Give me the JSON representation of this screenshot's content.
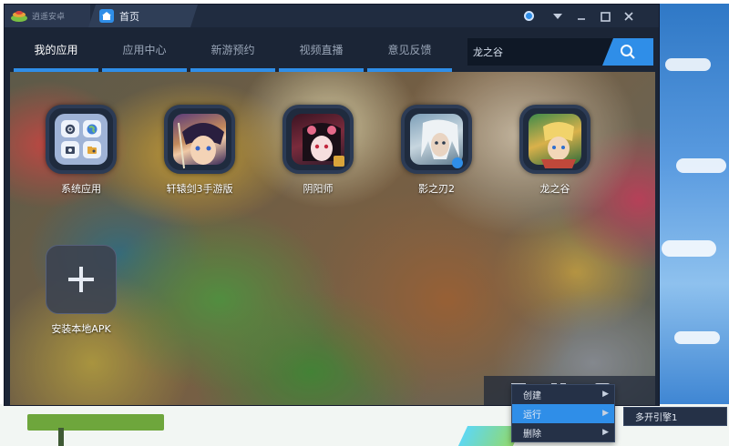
{
  "titlebar": {
    "brand_name": "逍遥安卓",
    "home_tab_label": "首页"
  },
  "nav": {
    "tabs": [
      {
        "label": "我的应用",
        "active": true
      },
      {
        "label": "应用中心",
        "active": false
      },
      {
        "label": "新游预约",
        "active": false
      },
      {
        "label": "视频直播",
        "active": false
      },
      {
        "label": "意见反馈",
        "active": false
      }
    ],
    "search_value": "龙之谷"
  },
  "apps": [
    {
      "label": "系统应用",
      "icon": "system-apps-icon"
    },
    {
      "label": "轩辕剑3手游版",
      "icon": "xuanyuan-game-icon"
    },
    {
      "label": "阴阳师",
      "icon": "onmyoji-game-icon"
    },
    {
      "label": "影之刃2",
      "icon": "blade-shadow-game-icon"
    },
    {
      "label": "龙之谷",
      "icon": "dragon-nest-game-icon"
    }
  ],
  "install_apk_label": "安装本地APK",
  "context_menu": {
    "items": [
      {
        "label": "创建",
        "has_submenu": true,
        "active": false
      },
      {
        "label": "运行",
        "has_submenu": true,
        "active": true
      },
      {
        "label": "删除",
        "has_submenu": true,
        "active": false
      }
    ],
    "submenu_item": "多开引擎1"
  },
  "colors": {
    "accent": "#2f8ee8",
    "window_bg": "#1b2536",
    "titlebar_bg": "#202c40"
  }
}
